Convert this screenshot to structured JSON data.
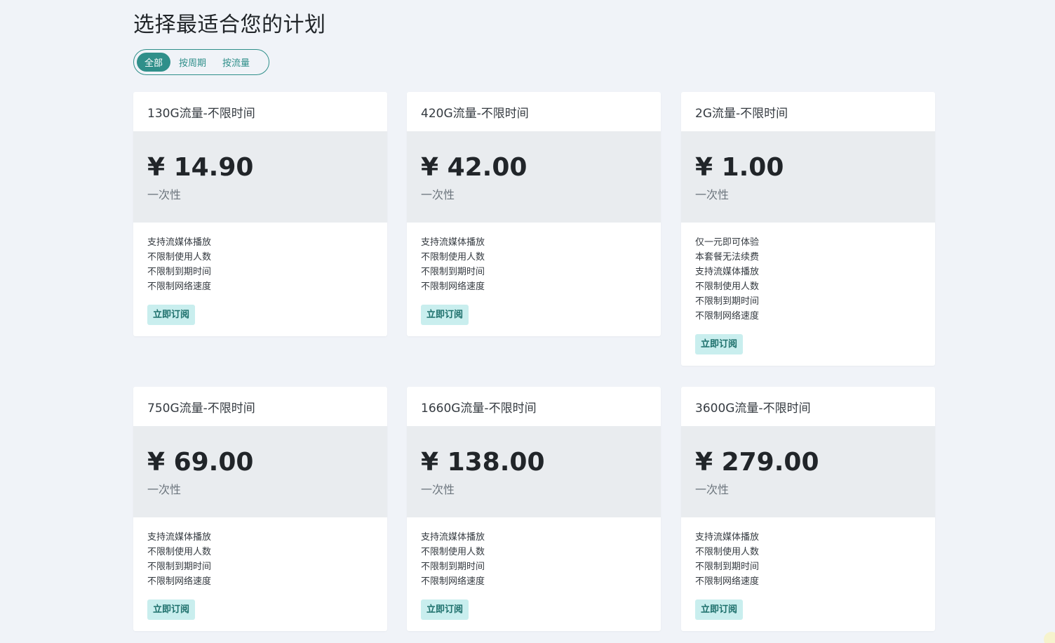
{
  "page": {
    "title": "选择最适合您的计划"
  },
  "filter": {
    "tabs": [
      {
        "label": "全部",
        "active": true
      },
      {
        "label": "按周期",
        "active": false
      },
      {
        "label": "按流量",
        "active": false
      }
    ]
  },
  "accent_color": "#2f8f8a",
  "plans": [
    {
      "name": "130G流量-不限时间",
      "price": "¥ 14.90",
      "period": "一次性",
      "features": [
        "支持流媒体播放",
        "不限制使用人数",
        "不限制到期时间",
        "不限制网络速度"
      ],
      "subscribe_label": "立即订阅"
    },
    {
      "name": "420G流量-不限时间",
      "price": "¥ 42.00",
      "period": "一次性",
      "features": [
        "支持流媒体播放",
        "不限制使用人数",
        "不限制到期时间",
        "不限制网络速度"
      ],
      "subscribe_label": "立即订阅"
    },
    {
      "name": "2G流量-不限时间",
      "price": "¥ 1.00",
      "period": "一次性",
      "features": [
        "仅一元即可体验",
        "本套餐无法续费",
        "支持流媒体播放",
        "不限制使用人数",
        "不限制到期时间",
        "不限制网络速度"
      ],
      "subscribe_label": "立即订阅"
    },
    {
      "name": "750G流量-不限时间",
      "price": "¥ 69.00",
      "period": "一次性",
      "features": [
        "支持流媒体播放",
        "不限制使用人数",
        "不限制到期时间",
        "不限制网络速度"
      ],
      "subscribe_label": "立即订阅"
    },
    {
      "name": "1660G流量-不限时间",
      "price": "¥ 138.00",
      "period": "一次性",
      "features": [
        "支持流媒体播放",
        "不限制使用人数",
        "不限制到期时间",
        "不限制网络速度"
      ],
      "subscribe_label": "立即订阅"
    },
    {
      "name": "3600G流量-不限时间",
      "price": "¥ 279.00",
      "period": "一次性",
      "features": [
        "支持流媒体播放",
        "不限制使用人数",
        "不限制到期时间",
        "不限制网络速度"
      ],
      "subscribe_label": "立即订阅"
    }
  ]
}
